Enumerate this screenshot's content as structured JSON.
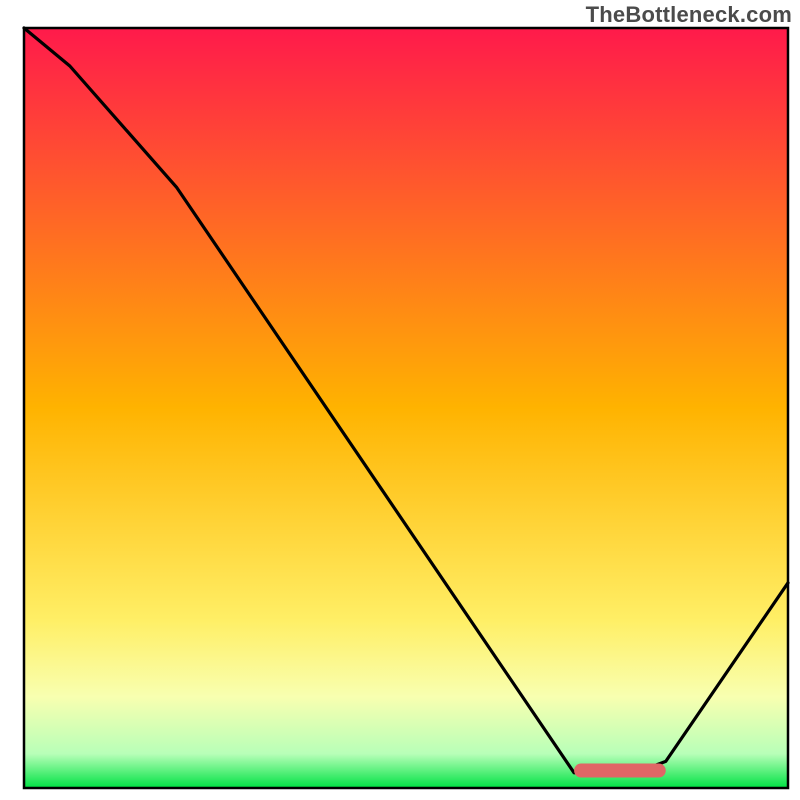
{
  "watermark": "TheBottleneck.com",
  "chart_data": {
    "type": "line",
    "title": "",
    "xlabel": "",
    "ylabel": "",
    "xlim": [
      0,
      100
    ],
    "ylim": [
      0,
      100
    ],
    "grid": false,
    "legend": false,
    "annotations": [],
    "series": [
      {
        "name": "bottleneck-curve",
        "x": [
          0,
          6,
          20,
          72,
          80,
          84,
          100
        ],
        "values": [
          100,
          95,
          79,
          2,
          2,
          3.5,
          27
        ]
      }
    ],
    "marker": {
      "name": "optimal-range",
      "x_range": [
        72,
        84
      ],
      "y": 2.3,
      "color": "#e06666"
    },
    "background_gradient": {
      "stops": [
        {
          "offset": 0.0,
          "color": "#ff1a4b"
        },
        {
          "offset": 0.5,
          "color": "#ffb300"
        },
        {
          "offset": 0.78,
          "color": "#ffef66"
        },
        {
          "offset": 0.88,
          "color": "#f8ffb0"
        },
        {
          "offset": 0.955,
          "color": "#b8ffb8"
        },
        {
          "offset": 1.0,
          "color": "#00e244"
        }
      ]
    },
    "colors": {
      "curve": "#000000",
      "frame": "#000000",
      "marker": "#e06666"
    }
  }
}
